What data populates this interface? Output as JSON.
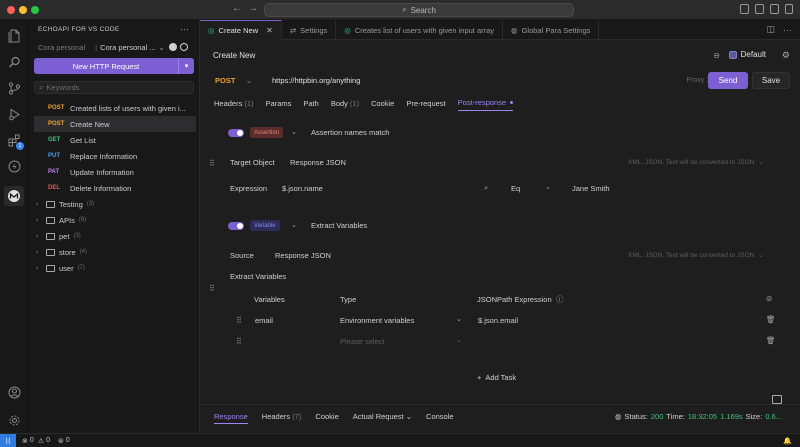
{
  "titlebar": {
    "search": "Search"
  },
  "sidebar": {
    "title": "ECHOAPI FOR VS CODE",
    "more": "···",
    "workspace_select": "Cora personal",
    "team": "Cora personal ...",
    "new_request": "New HTTP Request",
    "search_placeholder": "Keywords",
    "requests": [
      {
        "method": "POST",
        "name": "Created lists of users with given i...",
        "color": "#f0a030"
      },
      {
        "method": "POST",
        "name": "Create New",
        "color": "#f0a030"
      },
      {
        "method": "GET",
        "name": "Get List",
        "color": "#3fc47a"
      },
      {
        "method": "PUT",
        "name": "Replace Information",
        "color": "#4a9ef0"
      },
      {
        "method": "PAT",
        "name": "Update Information",
        "color": "#c080e0"
      },
      {
        "method": "DEL",
        "name": "Delete Information",
        "color": "#e05a5a"
      }
    ],
    "folders": [
      {
        "name": "Testing",
        "count": "(3)"
      },
      {
        "name": "APIs",
        "count": "(6)"
      },
      {
        "name": "pet",
        "count": "(3)"
      },
      {
        "name": "store",
        "count": "(4)"
      },
      {
        "name": "user",
        "count": "(7)"
      }
    ]
  },
  "tabs": [
    {
      "label": "Create New",
      "active": true
    },
    {
      "label": "Settings"
    },
    {
      "label": "Creates list of users with given input array"
    },
    {
      "label": "Global Para Settings"
    }
  ],
  "request": {
    "title": "Create New",
    "environment": "Default",
    "method": "POST",
    "url": "https://httpbin.org/anything",
    "port": "Proxy 1",
    "send": "Send",
    "save": "Save",
    "subtabs": [
      {
        "label": "Headers",
        "count": "(1)"
      },
      {
        "label": "Params",
        "count": ""
      },
      {
        "label": "Path",
        "count": ""
      },
      {
        "label": "Body",
        "count": "(1)"
      },
      {
        "label": "Cookie",
        "count": ""
      },
      {
        "label": "Pre-request",
        "count": ""
      },
      {
        "label": "Post-response",
        "count": "",
        "active": true
      }
    ]
  },
  "assertion": {
    "tag": "Assertion",
    "title": "Assertion names match",
    "target_label": "Target Object",
    "target_value": "Response JSON",
    "hint": "XML, JSON, Text will be converted to JSON",
    "expression_label": "Expression",
    "expression_value": "$.json.name",
    "operator": "Eq",
    "expected": "Jane Smith"
  },
  "extract": {
    "tag": "Variable",
    "title": "Extract Variables",
    "source_label": "Source",
    "source_value": "Response JSON",
    "hint": "XML, JSON, Text will be converted to JSON",
    "section_label": "Extract Variables",
    "col_variables": "Variables",
    "col_type": "Type",
    "col_path": "JSONPath Expression",
    "row_var": "email",
    "row_type": "Environment variables",
    "row_path": "$.json.email",
    "empty_type_placeholder": "Please select"
  },
  "add_task": "Add Task",
  "response": {
    "tabs": [
      {
        "label": "Response",
        "active": true
      },
      {
        "label": "Headers",
        "count": "(7)"
      },
      {
        "label": "Cookie"
      },
      {
        "label": "Actual Request",
        "caret": true
      },
      {
        "label": "Console"
      }
    ],
    "status_label": "Status:",
    "status_value": "200",
    "time_label": "Time:",
    "time_value": "18:32:05",
    "duration": "1.169s",
    "size_label": "Size:",
    "size_value": "0.6..."
  },
  "statusbar": {
    "errors": "0",
    "warnings": "0",
    "ports": "0"
  }
}
